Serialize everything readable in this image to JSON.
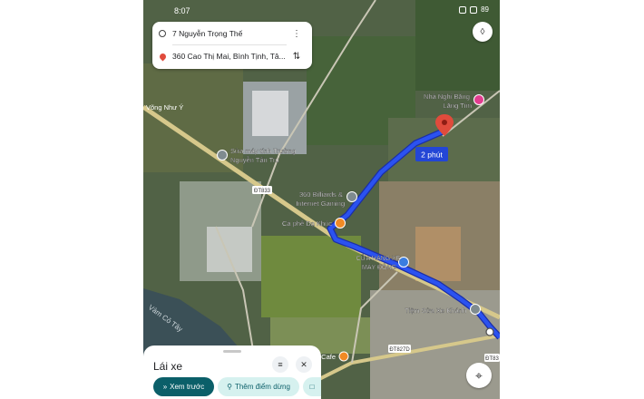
{
  "status_bar": {
    "time": "8:07",
    "battery": "89"
  },
  "route": {
    "origin": "7 Nguyễn Trọng Thế",
    "destination": "360 Cao Thị Mai, Bình Tịnh, Tâ...",
    "duration_label": "2 phút"
  },
  "map_labels": {
    "poi_motel": "Nhà Nghỉ Băng Lăng Tím",
    "poi_motel_line1": "Nhà Nghỉ Băng",
    "poi_motel_line2": "Lăng Tím",
    "poi_repair": "Sửa máy tính Trường Nguyễn Tấn Tru",
    "poi_repair_line1": "Sửa máy tính Trường",
    "poi_repair_line2": "Nguyễn Tấn Tru",
    "poi_billiards": "360 Billiards & Internet Gaming",
    "poi_billiards_line1": "360 Billiards &",
    "poi_billiards_line2": "Internet Gaming",
    "poi_cafe_da_khuc": "Cà phê Dạ Khúc",
    "poi_store": "CỬA HÀNG XE MÁY ĐÔNG",
    "poi_store_line1": "CỬA HÀNG XE",
    "poi_store_line2": "MÁY ĐÔNG",
    "poi_bike_repair": "Tiệm Sửa Xe Khánh",
    "poi_cafe_bottom": "Cafe",
    "poi_vong_nhu_y": "Võng Như Ý",
    "river": "Vàm Cỏ Tây",
    "road_dt833": "ĐT833",
    "road_dt827d": "ĐT827D",
    "road_dt83": "ĐT83"
  },
  "sheet": {
    "title": "Lái xe",
    "preview_button": "Xem trước",
    "add_stop_button": "Thêm điểm dừng"
  },
  "colors": {
    "route": "#2b52f0",
    "accent": "#0b5f69",
    "pin": "#e04b3c",
    "chip": "#d6f1ef"
  },
  "icons": [
    "more-vert-icon",
    "swap-icon",
    "layers-icon",
    "sliders-icon",
    "close-icon",
    "my-location-icon",
    "bookmark-icon",
    "add-stop-icon",
    "forward-icon"
  ]
}
